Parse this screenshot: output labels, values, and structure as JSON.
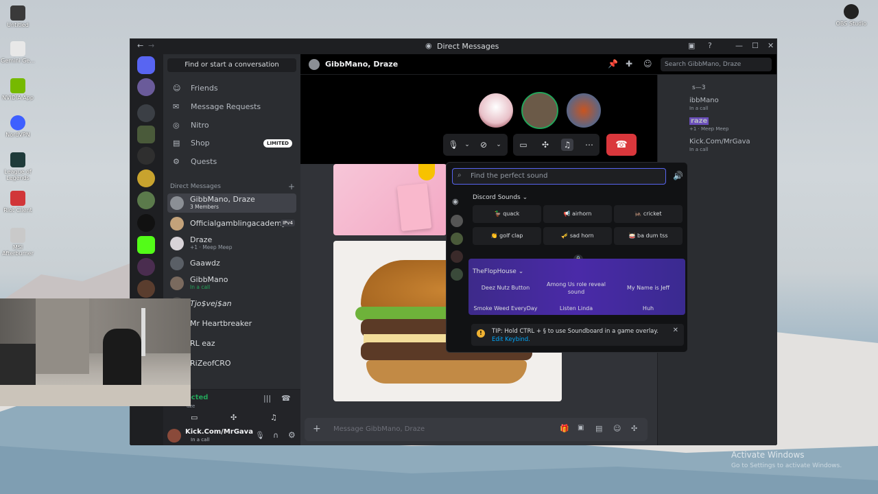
{
  "desktop": {
    "icons": [
      {
        "label": "Untitled",
        "color": "#3a3a3a"
      },
      {
        "label": "Gemini Ge...",
        "color": "#e8e8e8"
      },
      {
        "label": "NVIDIA App",
        "color": "#76b900"
      },
      {
        "label": "NordVPN",
        "color": "#3e5fff"
      },
      {
        "label": "League of Legends",
        "color": "#1f3b3a"
      },
      {
        "label": "Riot Client",
        "color": "#d13639"
      },
      {
        "label": "MSI Afterburner",
        "color": "#c9c9c9"
      }
    ],
    "right_icon": {
      "label": "OBS Studio"
    },
    "activate_title": "Activate Windows",
    "activate_sub": "Go to Settings to activate Windows."
  },
  "window": {
    "title": "Direct Messages",
    "controls": [
      "minimize",
      "maximize",
      "close"
    ]
  },
  "sidebar": {
    "find_placeholder": "Find or start a conversation",
    "nav": [
      {
        "label": "Friends",
        "icon": "friends-icon"
      },
      {
        "label": "Message Requests",
        "icon": "mail-icon"
      },
      {
        "label": "Nitro",
        "icon": "nitro-icon"
      },
      {
        "label": "Shop",
        "icon": "shop-icon",
        "badge": "LIMITED"
      },
      {
        "label": "Quests",
        "icon": "quests-icon"
      }
    ],
    "dm_header": "Direct Messages",
    "dms": [
      {
        "name": "GibbMano, Draze",
        "sub": "3 Members",
        "color": "#8b8f95"
      },
      {
        "name": "Officialgamblingacademy",
        "sub": "",
        "badge": "IPv4",
        "color": "#c3a27a"
      },
      {
        "name": "Draze",
        "sub": "+1 · Meep Meep",
        "color": "#d8d3d8"
      },
      {
        "name": "Gaawdz",
        "sub": "",
        "color": "#5a5f66"
      },
      {
        "name": "GibbMano",
        "sub": "In a call",
        "color": "#7a6a5e"
      },
      {
        "name": "Tjo$vej$an",
        "sub": "",
        "color": "#444"
      },
      {
        "name": "Mr Heartbreaker",
        "sub": "",
        "color": "#444"
      },
      {
        "name": "RL eaz",
        "sub": "",
        "color": "#444"
      },
      {
        "name": "RiZeofCRO",
        "sub": "",
        "color": "#444"
      }
    ],
    "voice_status": "ected",
    "voice_channel": "aze",
    "user": {
      "name": "Kick.Com/MrGava",
      "status": "In a call"
    }
  },
  "main": {
    "header_title": "GibbMano, Draze",
    "search_placeholder": "Search GibbMano, Draze",
    "message_placeholder": "Message GibbMano, Draze"
  },
  "right_panel": {
    "header": "s—3",
    "members": [
      {
        "name": "ibbMano",
        "sub": "In a call"
      },
      {
        "name": "raze",
        "sub": "+1 · Meep Meep"
      },
      {
        "name": "Kick.Com/MrGava",
        "sub": "In a call"
      }
    ]
  },
  "soundboard": {
    "search_placeholder": "Find the perfect sound",
    "section1": "Discord Sounds",
    "sounds": [
      "quack",
      "airhorn",
      "cricket",
      "golf clap",
      "sad horn",
      "ba dum tss"
    ],
    "section2": "TheFlopHouse",
    "custom_sounds": [
      "Deez Nutz Button",
      "Among Us role reveal sound",
      "My Name is Jeff",
      "Smoke Weed EveryDay",
      "Listen Linda",
      "Huh"
    ],
    "tip_text": "TIP: Hold CTRL + § to use Soundboard in a game overlay.",
    "tip_link": "Edit Keybind."
  },
  "colors": {
    "accent": "#5865f2",
    "danger": "#da373c",
    "online": "#23a55a"
  }
}
